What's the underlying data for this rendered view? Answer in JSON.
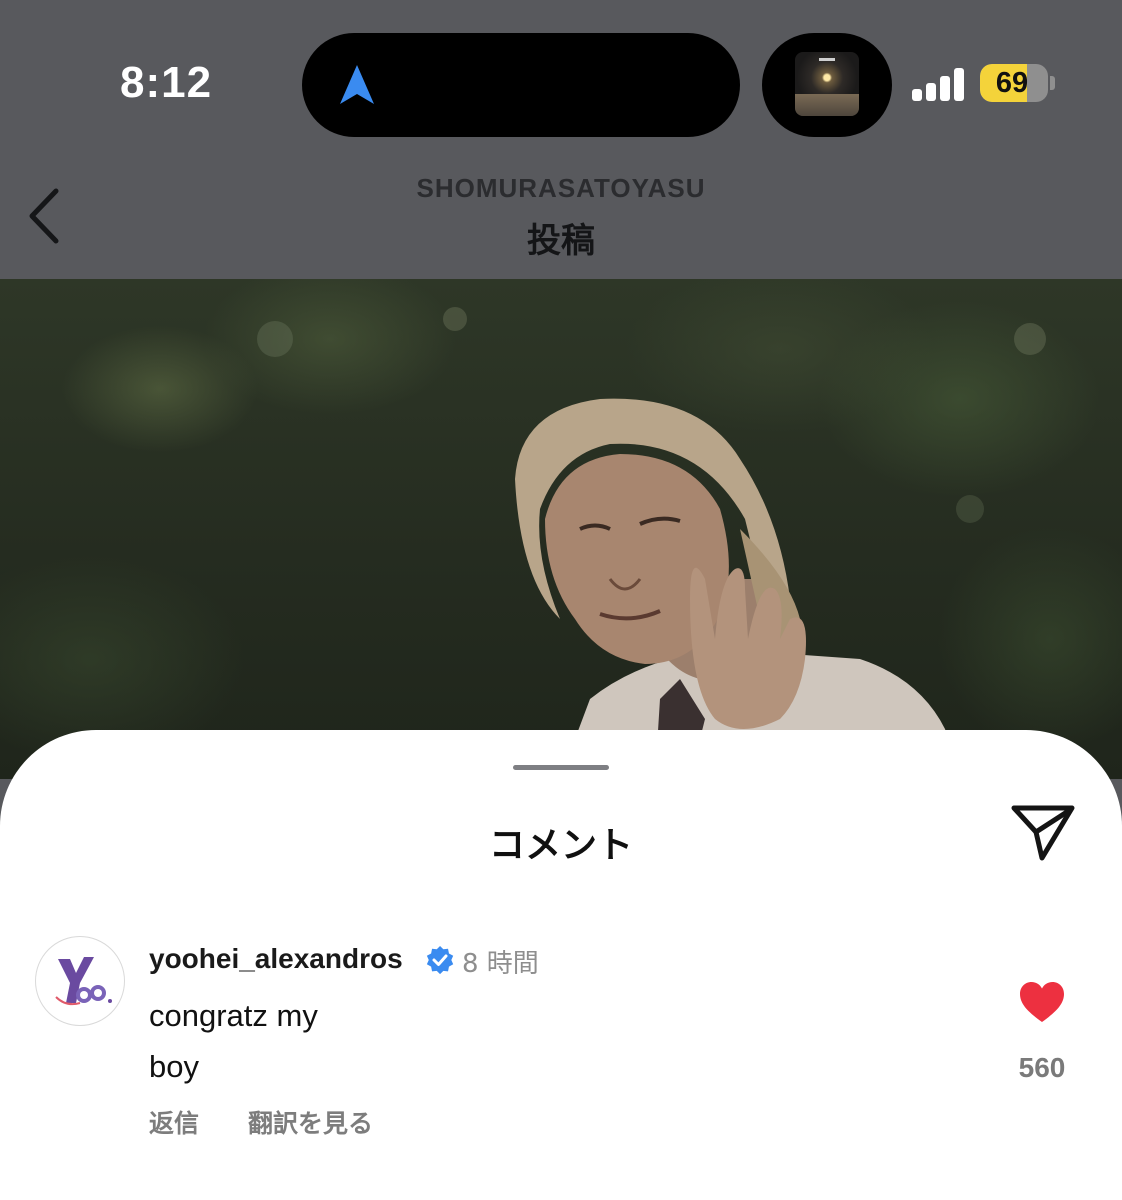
{
  "status_bar": {
    "time": "8:12",
    "battery_level": "69",
    "battery_fraction": 0.69,
    "live_activity_icon": "navigation-arrow-icon",
    "accent_blue": "#3a8bf0",
    "battery_color": "#f4d33a"
  },
  "header": {
    "username": "SHOMURASATOYASU",
    "title": "投稿",
    "back_icon": "chevron-left-icon"
  },
  "comments_sheet": {
    "title": "コメント",
    "share_icon": "paper-plane-icon",
    "comment": {
      "username": "yoohei_alexandros",
      "verified": true,
      "time": "8 時間",
      "text_line1": "congratz my",
      "text_line2": "boy",
      "reply_label": "返信",
      "translate_label": "翻訳を見る",
      "like_count": "560",
      "like_color": "#ed3040"
    }
  }
}
